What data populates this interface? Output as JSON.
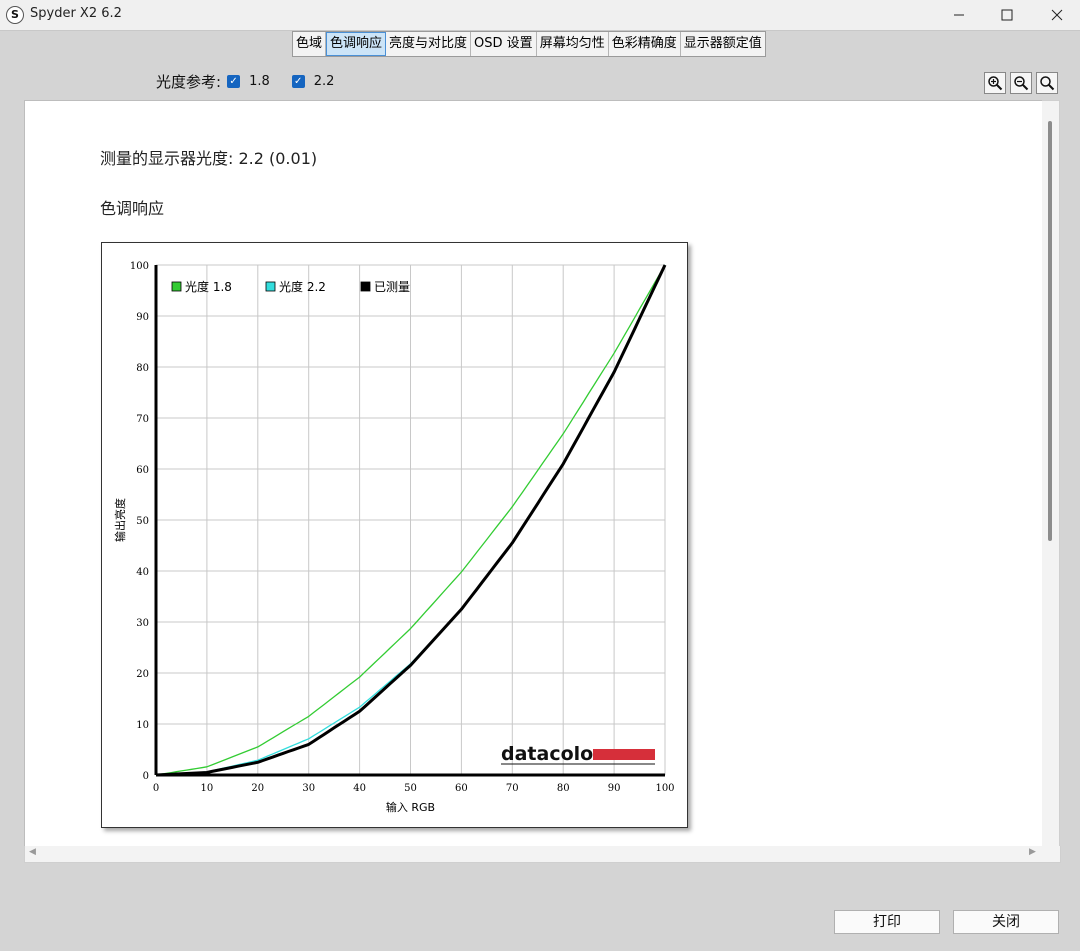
{
  "window": {
    "title": "Spyder X2 6.2",
    "app_icon": "S"
  },
  "tabs": [
    {
      "label": "色域"
    },
    {
      "label": "色调响应",
      "active": true
    },
    {
      "label": "亮度与对比度"
    },
    {
      "label": "OSD 设置"
    },
    {
      "label": "屏幕均匀性"
    },
    {
      "label": "色彩精确度"
    },
    {
      "label": "显示器额定值"
    }
  ],
  "reference": {
    "label": "光度参考:",
    "options": [
      {
        "value": "1.8",
        "checked": true
      },
      {
        "value": "2.2",
        "checked": true
      }
    ]
  },
  "content": {
    "measured_gamma": "测量的显示器光度:  2.2 (0.01)",
    "section_title": "色调响应"
  },
  "buttons": {
    "print": "打印",
    "close": "关闭"
  },
  "chart_data": {
    "type": "line",
    "xlabel": "输入 RGB",
    "ylabel": "输出亮度",
    "xlim": [
      0,
      100
    ],
    "ylim": [
      0,
      100
    ],
    "x_ticks": [
      0,
      10,
      20,
      30,
      40,
      50,
      60,
      70,
      80,
      90,
      100
    ],
    "y_ticks": [
      0,
      10,
      20,
      30,
      40,
      50,
      60,
      70,
      80,
      90,
      100
    ],
    "grid": true,
    "legend_position": "top-left",
    "watermark": "datacolor",
    "series": [
      {
        "name": "光度 1.8",
        "color": "#33cc33",
        "x": [
          0,
          10,
          20,
          30,
          40,
          50,
          60,
          70,
          80,
          90,
          100
        ],
        "y": [
          0,
          1.6,
          5.5,
          11.5,
          19.2,
          28.7,
          39.8,
          52.6,
          66.9,
          82.7,
          100
        ]
      },
      {
        "name": "光度 2.2",
        "color": "#33dddd",
        "x": [
          0,
          10,
          20,
          30,
          40,
          50,
          60,
          70,
          80,
          90,
          100
        ],
        "y": [
          0,
          0.6,
          2.9,
          7.1,
          13.3,
          21.8,
          32.5,
          45.6,
          61.2,
          79.3,
          100
        ]
      },
      {
        "name": "已测量",
        "color": "#000000",
        "x": [
          0,
          10,
          20,
          30,
          40,
          50,
          60,
          70,
          80,
          90,
          100
        ],
        "y": [
          0,
          0.5,
          2.5,
          6.0,
          12.5,
          21.5,
          32.5,
          45.5,
          61.0,
          79.0,
          100
        ]
      }
    ]
  }
}
